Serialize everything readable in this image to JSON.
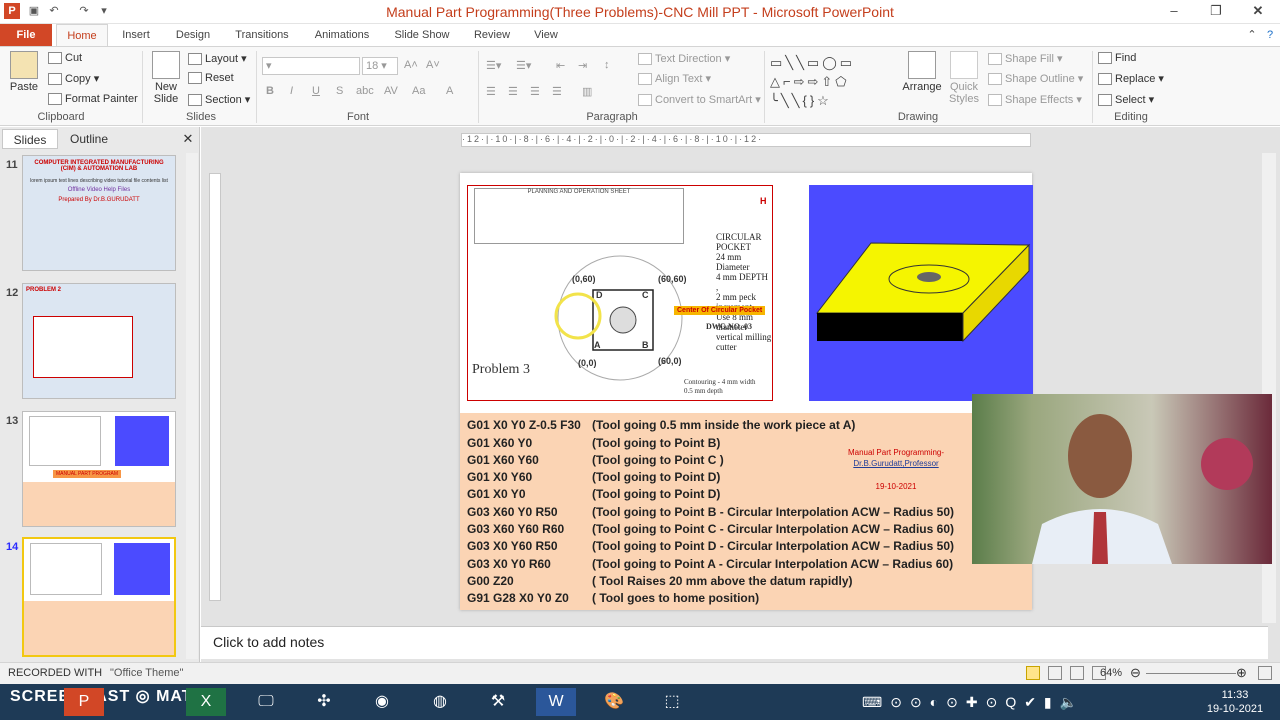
{
  "window": {
    "title": "Manual Part Programming(Three Problems)-CNC Mill PPT  -  Microsoft PowerPoint"
  },
  "tabs": [
    "File",
    "Home",
    "Insert",
    "Design",
    "Transitions",
    "Animations",
    "Slide Show",
    "Review",
    "View"
  ],
  "ribbon": {
    "clipboard": {
      "paste": "Paste",
      "cut": "Cut",
      "copy": "Copy",
      "format_painter": "Format Painter",
      "label": "Clipboard"
    },
    "slides": {
      "new_slide": "New Slide",
      "layout": "Layout",
      "reset": "Reset",
      "section": "Section",
      "label": "Slides"
    },
    "font": {
      "size": "18",
      "label": "Font"
    },
    "paragraph": {
      "text_direction": "Text Direction",
      "align_text": "Align Text",
      "convert": "Convert to SmartArt",
      "label": "Paragraph"
    },
    "drawing": {
      "arrange": "Arrange",
      "quick_styles": "Quick Styles",
      "shape_fill": "Shape Fill",
      "shape_outline": "Shape Outline",
      "shape_effects": "Shape Effects",
      "label": "Drawing"
    },
    "editing": {
      "find": "Find",
      "replace": "Replace",
      "select": "Select",
      "label": "Editing"
    }
  },
  "panel": {
    "tabs": [
      "Slides",
      "Outline"
    ],
    "slide_numbers": [
      "11",
      "12",
      "13",
      "14"
    ],
    "thumb11": {
      "title": "COMPUTER INTEGRATED MANUFACTURING (CIM) & AUTOMATION LAB",
      "sub1": "Offline Video Help Files",
      "sub2": "Prepared By Dr.B.GURUDATT"
    },
    "thumb12": {
      "title": "PROBLEM 2"
    },
    "thumb13": {
      "banner": "MANUAL PART PROGRAM"
    }
  },
  "slide": {
    "sheet_title": "PLANNING AND OPERATION SHEET",
    "pocket_text": [
      "CIRCULAR POCKET",
      "24 mm Diameter",
      "4 mm DEPTH ,",
      "2 mm peck increment",
      "Use 8 mm diameter",
      "vertical milling cutter"
    ],
    "problem_label": "Problem 3",
    "dwg": "DWG.NO. 03",
    "center_label": "Center Of Circular Pocket",
    "points": {
      "p060": "(0,60)",
      "p6060": "(60,60)",
      "p600": "(60,0)",
      "p00": "(0,0)"
    },
    "corner": {
      "d": "D",
      "c": "C",
      "a": "A",
      "b": "B"
    },
    "contour": "Contouring - 4 mm width",
    "contour2": "0.5 mm depth",
    "author": {
      "line1": "Manual Part Programming-",
      "line2": "Dr.B.Gurudatt,Professor",
      "date": "19-10-2021"
    },
    "code": [
      {
        "cmd": "G01 X0 Y0 Z-0.5 F30",
        "cmt": "(Tool going 0.5 mm inside the work piece at A)"
      },
      {
        "cmd": "G01 X60 Y0",
        "cmt": "(Tool going to Point B)"
      },
      {
        "cmd": "G01 X60 Y60",
        "cmt": "(Tool going to Point C )"
      },
      {
        "cmd": "G01 X0 Y60",
        "cmt": "(Tool going to Point D)"
      },
      {
        "cmd": "G01 X0 Y0",
        "cmt": "(Tool going to Point D)"
      },
      {
        "cmd": "G03 X60 Y0 R50",
        "cmt": "(Tool going to Point B  - Circular Interpolation ACW – Radius 50)"
      },
      {
        "cmd": "G03 X60 Y60 R60",
        "cmt": "(Tool going to Point C  - Circular Interpolation ACW – Radius 60)"
      },
      {
        "cmd": "G03 X0 Y60 R50",
        "cmt": "(Tool going to Point D  - Circular Interpolation ACW – Radius 50)"
      },
      {
        "cmd": "G03 X0 Y0 R60",
        "cmt": "(Tool going to Point A  - Circular Interpolation ACW – Radius 60)"
      },
      {
        "cmd": "G00 Z20",
        "cmt": "( Tool Raises 20 mm above the datum rapidly)"
      },
      {
        "cmd": "G91 G28 X0 Y0 Z0",
        "cmt": "( Tool goes to home position)"
      }
    ]
  },
  "notes": {
    "placeholder": "Click to add notes"
  },
  "status": {
    "theme": "\"Office Theme\"",
    "zoom": "64%",
    "watermark": "RECORDED WITH",
    "brand": "SCREENCAST",
    "brand2": "MATIC"
  },
  "taskbar": {
    "time": "11:33",
    "date": "19-10-2021"
  },
  "colors": {
    "accent": "#c43e1c",
    "file_tab": "#d24726",
    "code_bg": "#fbd4b4",
    "model_bg": "#4b4bff"
  }
}
